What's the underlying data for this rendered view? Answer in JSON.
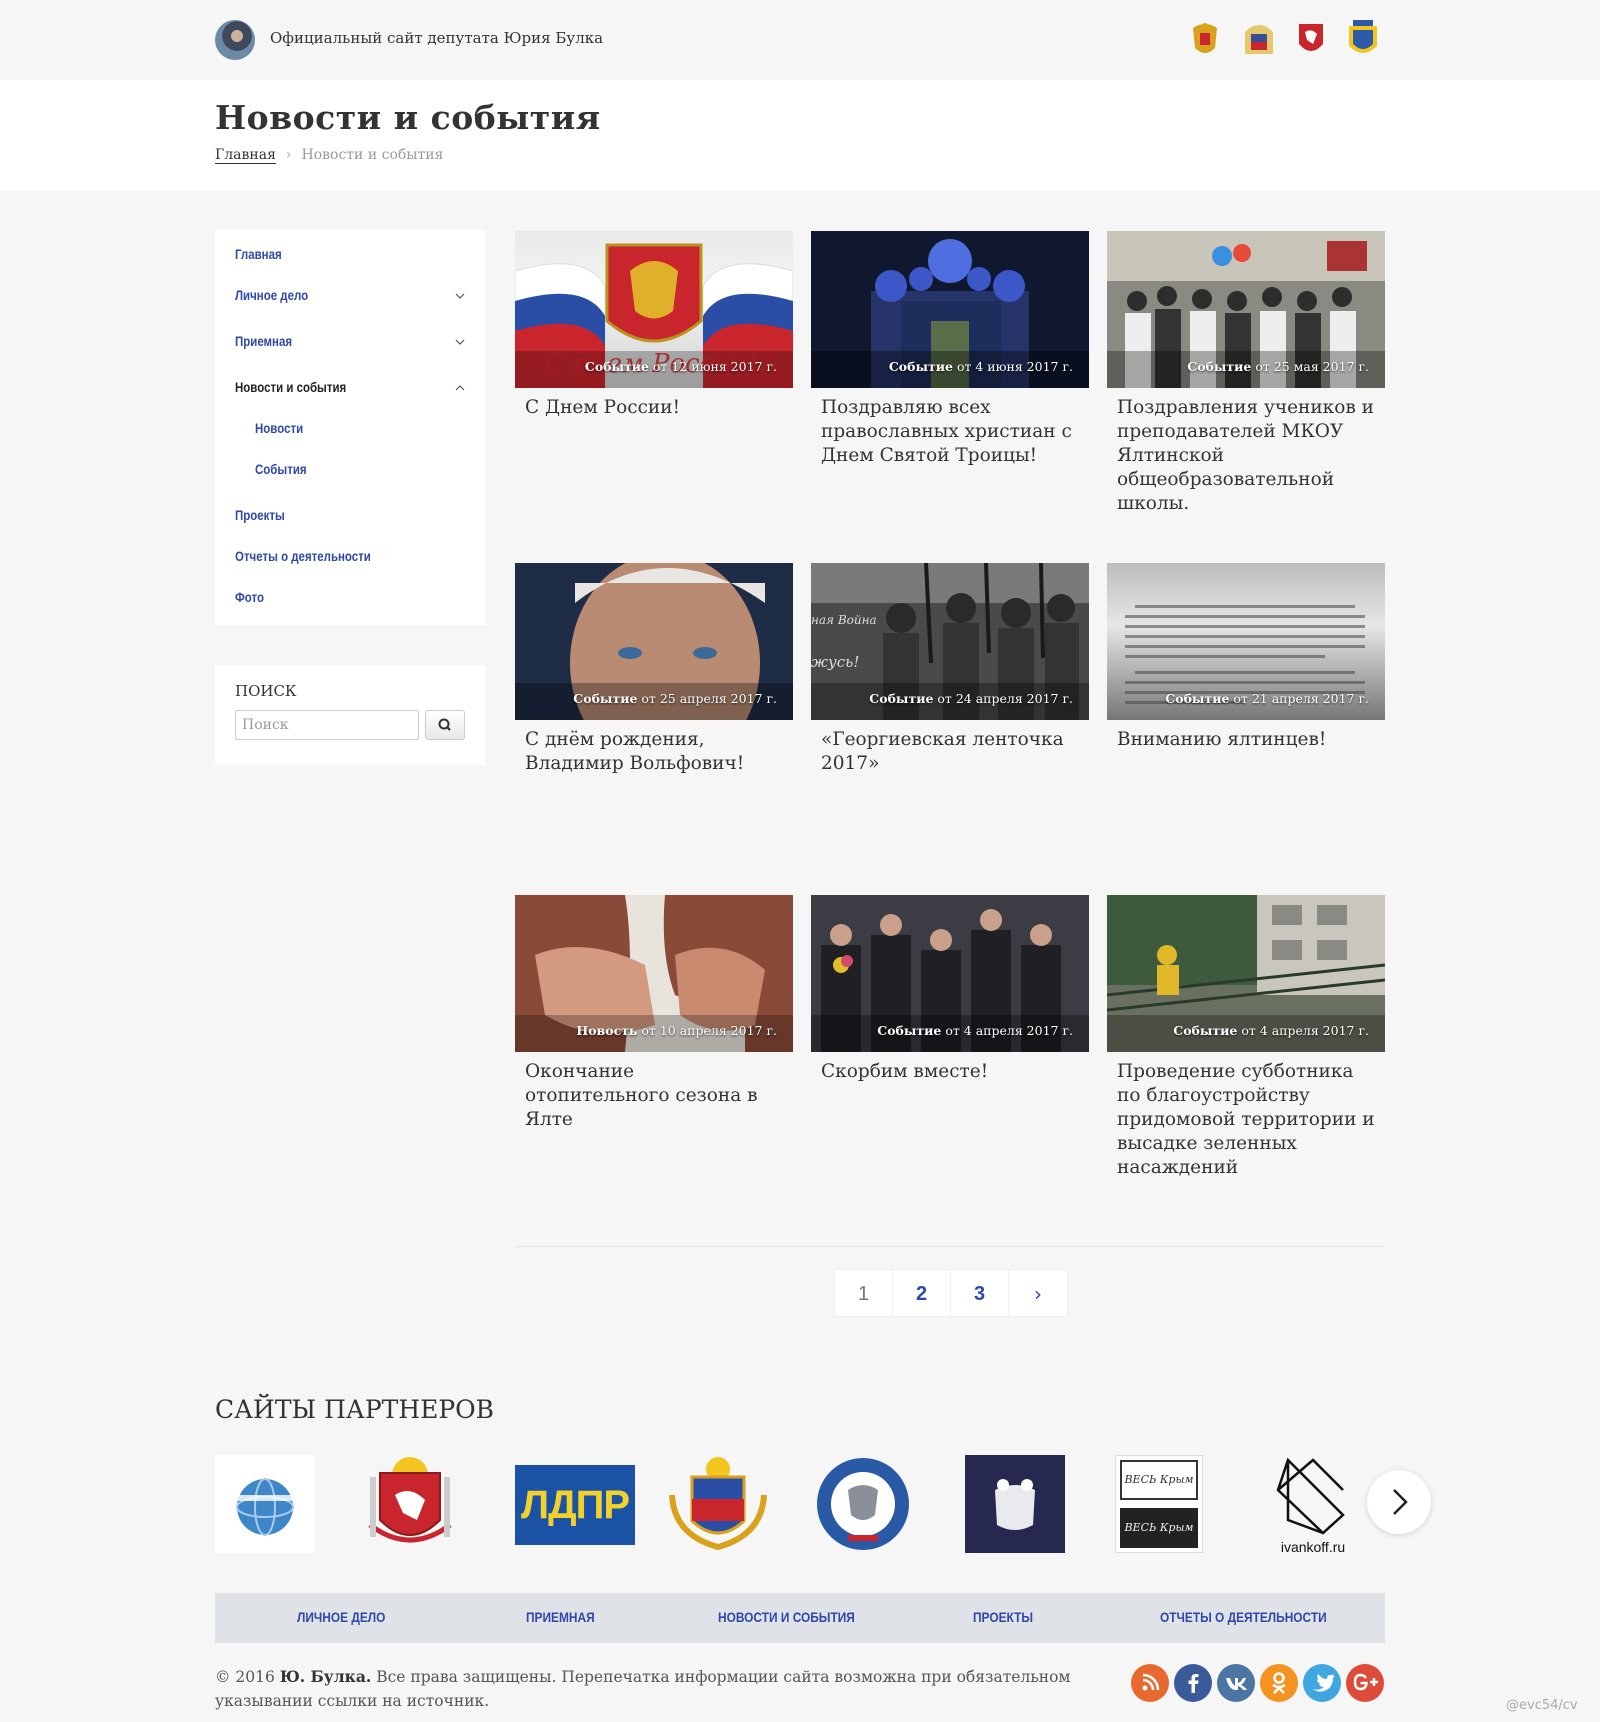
{
  "topbar": {
    "site_title": "Официальный сайт депутата Юрия Булка"
  },
  "header": {
    "title": "Новости и события",
    "breadcrumb": {
      "home": "Главная",
      "current": "Новости и события"
    }
  },
  "sidebar": {
    "items": [
      {
        "label": "Главная"
      },
      {
        "label": "Личное дело"
      },
      {
        "label": "Приемная"
      },
      {
        "label": "Новости и события"
      },
      {
        "label": "Новости"
      },
      {
        "label": "События"
      },
      {
        "label": "Проекты"
      },
      {
        "label": "Отчеты о деятельности"
      },
      {
        "label": "Фото"
      }
    ],
    "search": {
      "title": "ПОИСК",
      "placeholder": "Поиск"
    }
  },
  "cards": [
    {
      "type": "Событие",
      "date": "от 12 июня 2017 г.",
      "title": "С Днем России!"
    },
    {
      "type": "Событие",
      "date": "от 4 июня 2017 г.",
      "title": "Поздравляю всех православных христиан с Днем Святой Троицы!"
    },
    {
      "type": "Событие",
      "date": "от 25 мая 2017 г.",
      "title": "Поздравления учеников и преподавателей МКОУ Ялтинской общеобразовательной школы."
    },
    {
      "type": "Событие",
      "date": "от 25 апреля 2017 г.",
      "title": "С днём рождения, Владимир Вольфович!"
    },
    {
      "type": "Событие",
      "date": "от 24 апреля 2017 г.",
      "title": "«Георгиевская ленточка 2017»"
    },
    {
      "type": "Событие",
      "date": "от 21 апреля 2017 г.",
      "title": "Вниманию ялтинцев!"
    },
    {
      "type": "Новость",
      "date": "от 10 апреля 2017 г.",
      "title": "Окончание отопительного сезона в Ялте"
    },
    {
      "type": "Событие",
      "date": "от 4 апреля 2017 г.",
      "title": "Скорбим вместе!"
    },
    {
      "type": "Событие",
      "date": "от 4 апреля 2017 г.",
      "title": "Проведение субботника по благоустройству придомовой территории и высадке зеленных насаждений"
    }
  ],
  "image_text": {
    "russia_day": "С днем России!",
    "war_line1": "ная Война",
    "war_line2": "жусь!"
  },
  "pagination": {
    "pages": [
      "1",
      "2",
      "3"
    ],
    "next": "›"
  },
  "partners": {
    "title": "САЙТЫ ПАРТНЕРОВ",
    "ldpr": "ЛДПР",
    "ivankoff": "ivankoff.ru",
    "ves_krym": "ВЕСЬ Крым"
  },
  "footer": {
    "nav": [
      "ЛИЧНОЕ ДЕЛО",
      "ПРИЕМНАЯ",
      "НОВОСТИ И СОБЫТИЯ",
      "ПРОЕКТЫ",
      "ОТЧЕТЫ О ДЕЯТЕЛЬНОСТИ"
    ],
    "copyright_pre": "© 2016 ",
    "copyright_name": "Ю. Булка.",
    "copyright_post": " Все права защищены. Перепечатка информации сайта возможна при обязательном указывании ссылки на источник."
  },
  "socials": [
    {
      "name": "rss-icon",
      "color": "#e8692f"
    },
    {
      "name": "facebook-icon",
      "color": "#3b5a9a"
    },
    {
      "name": "vk-icon",
      "color": "#4c75a3"
    },
    {
      "name": "odnoklassniki-icon",
      "color": "#f59322"
    },
    {
      "name": "twitter-icon",
      "color": "#3fa6df"
    },
    {
      "name": "google-plus-icon",
      "color": "#dd4b39"
    }
  ],
  "watermark": "@evc54/cv"
}
